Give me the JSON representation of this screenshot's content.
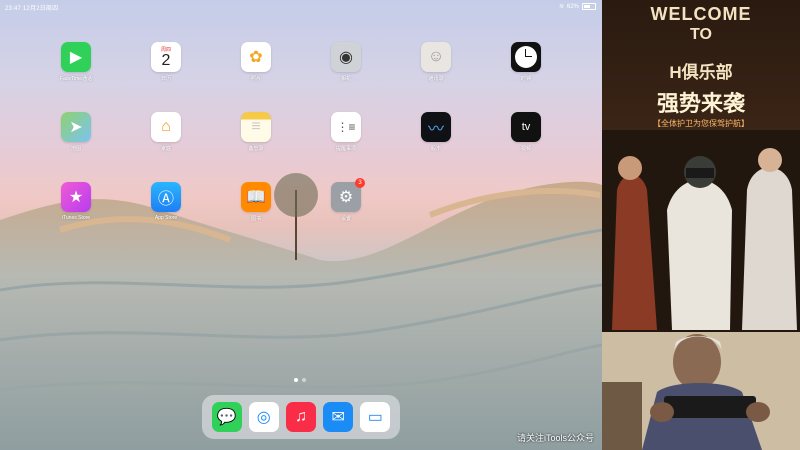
{
  "statusbar": {
    "time": "23:47",
    "date": "12月2日周四",
    "battery": "62%"
  },
  "apps": [
    {
      "label": "FaceTime通话",
      "icon": "facetime-icon",
      "color": "#2fd158"
    },
    {
      "label": "日历",
      "icon": "calendar-icon",
      "color": "#ffffff",
      "day_name": "周四",
      "day_num": "2"
    },
    {
      "label": "照片",
      "icon": "photos-icon",
      "color": "#ffffff"
    },
    {
      "label": "相机",
      "icon": "camera-icon",
      "color": "#cfd3d8"
    },
    {
      "label": "通讯录",
      "icon": "contacts-icon",
      "color": "#e9e6e1"
    },
    {
      "label": "时钟",
      "icon": "clock-icon",
      "color": "#111111"
    },
    {
      "label": "地图",
      "icon": "maps-icon",
      "color": "#7cc3f2"
    },
    {
      "label": "家庭",
      "icon": "home-icon",
      "color": "#ffffff"
    },
    {
      "label": "备忘录",
      "icon": "notes-icon",
      "color": "#fffbe6"
    },
    {
      "label": "提醒事项",
      "icon": "reminders-icon",
      "color": "#ffffff"
    },
    {
      "label": "股市",
      "icon": "stocks-icon",
      "color": "#0f1115"
    },
    {
      "label": "视频",
      "icon": "tv-icon",
      "color": "#111111"
    },
    {
      "label": "iTunes Store",
      "icon": "itunes-store-icon",
      "color": "#e93cc8"
    },
    {
      "label": "App Store",
      "icon": "app-store-icon",
      "color": "#1e8ff5"
    },
    {
      "label": "图书",
      "icon": "books-icon",
      "color": "#ff8a00"
    },
    {
      "label": "设置",
      "icon": "settings-icon",
      "color": "#9aa0a6",
      "badge": "3"
    }
  ],
  "dock": [
    {
      "label": "信息",
      "icon": "messages-icon",
      "color": "#2fd158"
    },
    {
      "label": "Safari浏览器",
      "icon": "safari-icon",
      "color": "#ffffff"
    },
    {
      "label": "音乐",
      "icon": "music-icon",
      "color": "#fa2d48"
    },
    {
      "label": "邮件",
      "icon": "mail-icon",
      "color": "#1b8cf5"
    },
    {
      "label": "文件",
      "icon": "files-icon",
      "color": "#ffffff"
    }
  ],
  "watermark": "请关注iTools公众号",
  "promo": {
    "line1": "WELCOME",
    "line2": "TO",
    "line3": "H俱乐部",
    "line4": "强势来袭",
    "line5": "【全体护卫为您保驾护航】"
  }
}
